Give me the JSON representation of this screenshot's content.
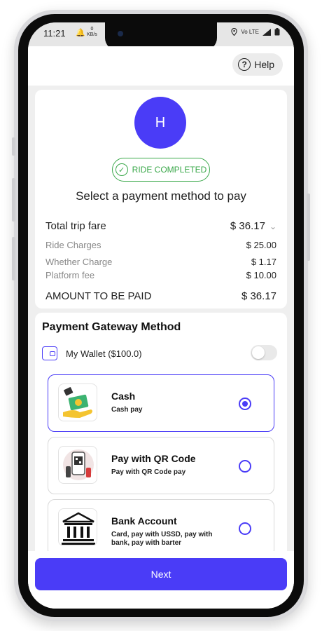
{
  "status_bar": {
    "time": "11:21",
    "speed_value": "0",
    "speed_unit": "KB/s",
    "network": "Vo LTE"
  },
  "header": {
    "help_label": "Help"
  },
  "summary": {
    "avatar_initial": "H",
    "status_badge": "RIDE COMPLETED",
    "prompt": "Select a payment method to pay",
    "total_label": "Total trip fare",
    "total_value": "$ 36.17",
    "items": [
      {
        "label": "Ride Charges",
        "value": "$ 25.00"
      },
      {
        "label": "Whether Charge",
        "value": "$ 1.17"
      },
      {
        "label": "Platform fee",
        "value": "$ 10.00"
      }
    ],
    "amount_label": "AMOUNT TO BE PAID",
    "amount_value": "$ 36.17"
  },
  "payment": {
    "title": "Payment Gateway Method",
    "wallet_label": "My Wallet ($100.0)",
    "wallet_enabled": false,
    "options": [
      {
        "title": "Cash",
        "subtitle": "Cash pay",
        "selected": true
      },
      {
        "title": "Pay with QR Code",
        "subtitle": "Pay with QR Code pay",
        "selected": false
      },
      {
        "title": "Bank Account",
        "subtitle": "Card, pay with USSD, pay with bank, pay with barter",
        "selected": false
      }
    ]
  },
  "footer": {
    "next_label": "Next"
  },
  "colors": {
    "accent": "#4a3cf7",
    "success": "#3aa84a"
  }
}
